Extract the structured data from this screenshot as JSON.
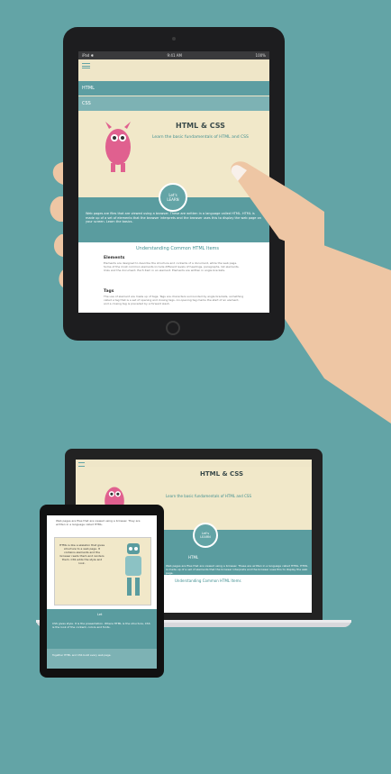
{
  "colors": {
    "background": "#63a4a6",
    "teal": "#5a9c9f",
    "cream": "#f1e8c9",
    "device": "#1d1d1f",
    "skin": "#eec6a4",
    "monster": "#e0608f"
  },
  "tablet_top": {
    "status": {
      "left": "iPad ✱",
      "center": "9:41 AM",
      "right": "100%"
    },
    "nav": {
      "item1": "HTML",
      "item2": "CSS"
    },
    "hero": {
      "title": "HTML & CSS",
      "subtitle": "Learn the basic fundamentals of HTML and CSS"
    },
    "badge": {
      "line1": "Let's",
      "line2": "LEARN"
    },
    "intro": "Web pages are files that are viewed using a browser. These are written in a language called HTML. HTML is made up of a set of elements that the browser interprets and the browser uses this to display the web page on your screen. Learn the basics.",
    "section_title": "Understanding Common HTML Items",
    "items": [
      {
        "heading": "Elements",
        "text": "Elements are designed to describe the structure and contents of a document, while the web page. Some of the most common elements include different levels of headings, paragraphs, list elements, links and the document. Each item in an element. Elements are written in angle brackets."
      },
      {
        "heading": "Tags",
        "text": "The use of element are made up of tags. Tags are characters surrounded by angle brackets, something called a tag that is a set of opening and closing tags. An opening tag marks the start of an element, and a closing tag is preceded by a forward slash."
      }
    ]
  },
  "laptop": {
    "title": "HTML & CSS",
    "subtitle": "Learn the basic fundamentals of HTML and CSS",
    "badge": {
      "line1": "Let's",
      "line2": "LEARN"
    },
    "nav_label": "HTML",
    "intro": "Web pages are files that are viewed using a browser. These are written in a language called HTML. HTML is made up of a set of elements that the browser interprets and the browser uses this to display the web page.",
    "section_title": "Understanding Common HTML Items"
  },
  "tablet_small": {
    "intro": "Web pages are files that are viewed using a browser. They are written in a language called HTML.",
    "box_text": "HTML is like a skeleton that gives structure to a web page. It contains elements and the browser reads them and renders them. CSS adds the style and look.",
    "footer_title": "Let",
    "footer_text": "CSS gives style. It is the presentation. Where HTML is the structure, CSS is the look of the content, colors and fonts.",
    "footer_small": "Together HTML and CSS build every web page."
  }
}
